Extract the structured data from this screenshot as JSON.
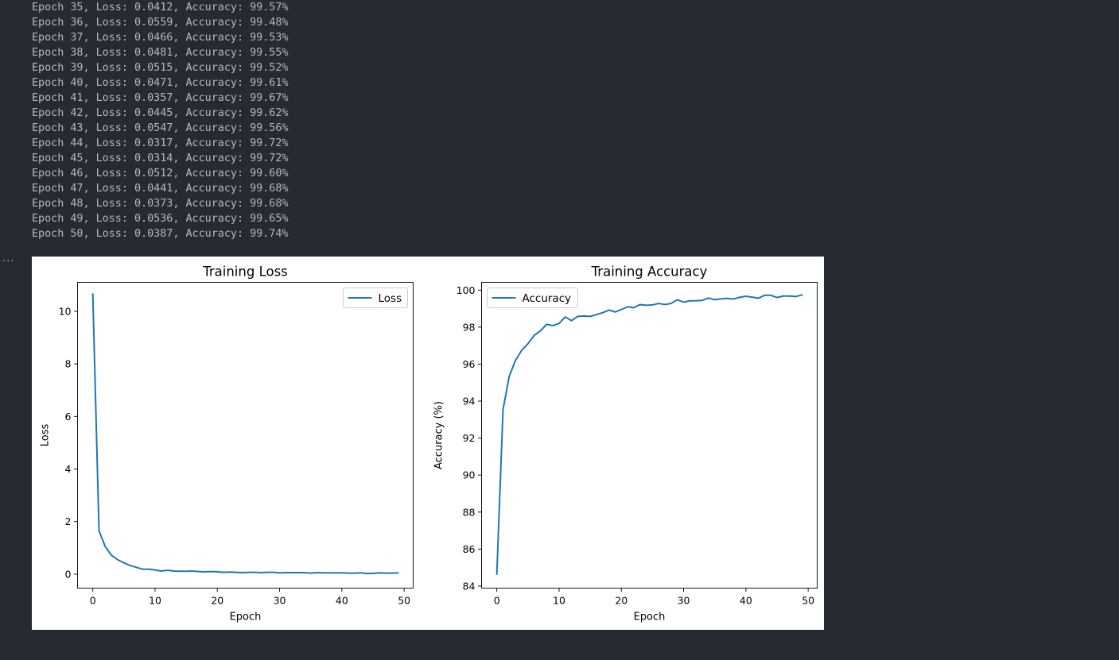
{
  "log": {
    "lines": [
      "Epoch 35, Loss: 0.0412, Accuracy: 99.57%",
      "Epoch 36, Loss: 0.0559, Accuracy: 99.48%",
      "Epoch 37, Loss: 0.0466, Accuracy: 99.53%",
      "Epoch 38, Loss: 0.0481, Accuracy: 99.55%",
      "Epoch 39, Loss: 0.0515, Accuracy: 99.52%",
      "Epoch 40, Loss: 0.0471, Accuracy: 99.61%",
      "Epoch 41, Loss: 0.0357, Accuracy: 99.67%",
      "Epoch 42, Loss: 0.0445, Accuracy: 99.62%",
      "Epoch 43, Loss: 0.0547, Accuracy: 99.56%",
      "Epoch 44, Loss: 0.0317, Accuracy: 99.72%",
      "Epoch 45, Loss: 0.0314, Accuracy: 99.72%",
      "Epoch 46, Loss: 0.0512, Accuracy: 99.60%",
      "Epoch 47, Loss: 0.0441, Accuracy: 99.68%",
      "Epoch 48, Loss: 0.0373, Accuracy: 99.68%",
      "Epoch 49, Loss: 0.0536, Accuracy: 99.65%",
      "Epoch 50, Loss: 0.0387, Accuracy: 99.74%"
    ]
  },
  "output_collapse_label": "...",
  "colors": {
    "background": "#262a33",
    "log_text": "#b4b9c1",
    "series": "#1f77b4"
  },
  "chart_data": [
    {
      "type": "line",
      "title": "Training Loss",
      "xlabel": "Epoch",
      "ylabel": "Loss",
      "xlim": [
        -2.45,
        51.45
      ],
      "ylim": [
        -0.53,
        11.1
      ],
      "xticks": [
        0,
        10,
        20,
        30,
        40,
        50
      ],
      "yticks": [
        0,
        2,
        4,
        6,
        8,
        10
      ],
      "legend": "upper right",
      "series": [
        {
          "name": "Loss",
          "color": "#1f77b4",
          "x": [
            0,
            1,
            2,
            3,
            4,
            5,
            6,
            7,
            8,
            9,
            10,
            11,
            12,
            13,
            14,
            15,
            16,
            17,
            18,
            19,
            20,
            21,
            22,
            23,
            24,
            25,
            26,
            27,
            28,
            29,
            30,
            31,
            32,
            33,
            34,
            35,
            36,
            37,
            38,
            39,
            40,
            41,
            42,
            43,
            44,
            45,
            46,
            47,
            48,
            49
          ],
          "values": [
            10.65,
            1.65,
            1.05,
            0.72,
            0.55,
            0.43,
            0.33,
            0.26,
            0.19,
            0.19,
            0.16,
            0.12,
            0.15,
            0.12,
            0.11,
            0.11,
            0.12,
            0.1,
            0.09,
            0.1,
            0.09,
            0.07,
            0.08,
            0.07,
            0.06,
            0.07,
            0.07,
            0.06,
            0.07,
            0.07,
            0.05,
            0.06,
            0.06,
            0.06,
            0.06,
            0.04,
            0.06,
            0.05,
            0.05,
            0.05,
            0.05,
            0.04,
            0.04,
            0.05,
            0.03,
            0.03,
            0.05,
            0.04,
            0.04,
            0.05
          ]
        }
      ]
    },
    {
      "type": "line",
      "title": "Training Accuracy",
      "xlabel": "Epoch",
      "ylabel": "Accuracy (%)",
      "xlim": [
        -2.45,
        51.45
      ],
      "ylim": [
        83.89,
        100.42
      ],
      "xticks": [
        0,
        10,
        20,
        30,
        40,
        50
      ],
      "yticks": [
        84,
        86,
        88,
        90,
        92,
        94,
        96,
        98,
        100
      ],
      "legend": "upper left",
      "series": [
        {
          "name": "Accuracy",
          "color": "#1f77b4",
          "x": [
            0,
            1,
            2,
            3,
            4,
            5,
            6,
            7,
            8,
            9,
            10,
            11,
            12,
            13,
            14,
            15,
            16,
            17,
            18,
            19,
            20,
            21,
            22,
            23,
            24,
            25,
            26,
            27,
            28,
            29,
            30,
            31,
            32,
            33,
            34,
            35,
            36,
            37,
            38,
            39,
            40,
            41,
            42,
            43,
            44,
            45,
            46,
            47,
            48,
            49
          ],
          "values": [
            84.65,
            93.55,
            95.35,
            96.2,
            96.75,
            97.1,
            97.55,
            97.8,
            98.15,
            98.08,
            98.2,
            98.55,
            98.35,
            98.58,
            98.6,
            98.58,
            98.68,
            98.78,
            98.92,
            98.82,
            98.95,
            99.1,
            99.05,
            99.22,
            99.18,
            99.2,
            99.28,
            99.22,
            99.28,
            99.48,
            99.35,
            99.42,
            99.42,
            99.45,
            99.57,
            99.48,
            99.53,
            99.55,
            99.52,
            99.61,
            99.67,
            99.62,
            99.56,
            99.72,
            99.72,
            99.6,
            99.68,
            99.68,
            99.65,
            99.74
          ]
        }
      ]
    }
  ]
}
